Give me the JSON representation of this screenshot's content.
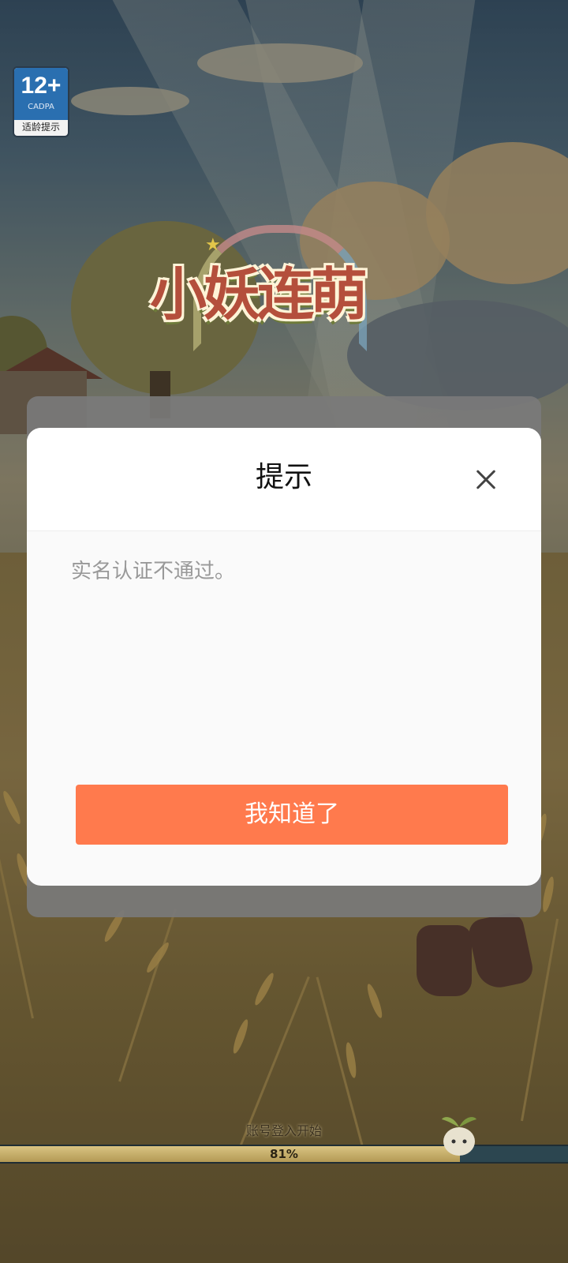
{
  "age_rating": {
    "value": "12+",
    "org": "CADPA",
    "tip": "适龄提示"
  },
  "game": {
    "logo_text": "小妖连萌"
  },
  "dialog": {
    "title": "提示",
    "message": "实名认证不通过。",
    "confirm_label": "我知道了",
    "close_icon": "close-icon"
  },
  "loading": {
    "status": "账号登入开始",
    "progress_text": "81%",
    "progress_value": 0.81
  },
  "colors": {
    "accent": "#ff7a4d",
    "dialog_bg": "#fafafa",
    "title_text": "#111111",
    "message_text": "#999999"
  }
}
